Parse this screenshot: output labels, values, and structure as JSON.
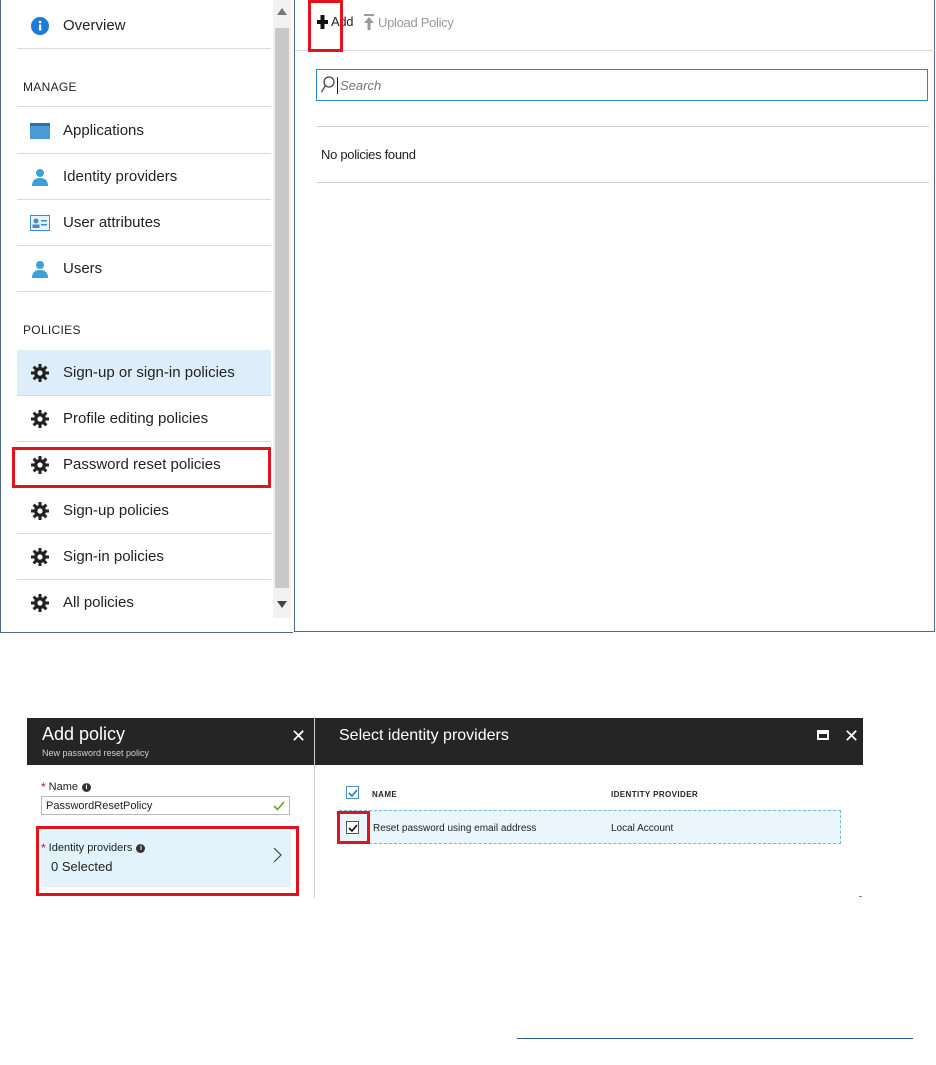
{
  "sidebar": {
    "overview": "Overview",
    "manage_header": "MANAGE",
    "manage_items": [
      "Applications",
      "Identity providers",
      "User attributes",
      "Users"
    ],
    "policies_header": "POLICIES",
    "policy_items": [
      "Sign-up or sign-in policies",
      "Profile editing policies",
      "Password reset policies",
      "Sign-up policies",
      "Sign-in policies",
      "All policies"
    ],
    "selected_item": "Sign-up or sign-in policies",
    "highlighted_item": "Password reset policies"
  },
  "toolbar": {
    "add_label": "Add",
    "upload_label": "Upload Policy"
  },
  "search": {
    "placeholder": "Search"
  },
  "content": {
    "empty_message": "No policies found"
  },
  "add_policy": {
    "title": "Add policy",
    "subtitle": "New password reset policy",
    "name_label": "Name",
    "name_value": "PasswordResetPolicy",
    "identity_label": "Identity providers",
    "identity_value": "0 Selected"
  },
  "select_idp": {
    "title": "Select identity providers",
    "columns": [
      "NAME",
      "IDENTITY PROVIDER"
    ],
    "rows": [
      {
        "name": "Reset password using email address",
        "provider": "Local Account",
        "checked": true
      }
    ]
  },
  "colors": {
    "highlight": "#e0141e",
    "selected_bg": "#ddeefa",
    "accent": "#2a88c8",
    "blade_header": "#252526",
    "overview_icon": "#1e7bd6"
  },
  "icons": [
    "info-icon",
    "application-icon",
    "user-icon",
    "contact-card-icon",
    "gear-icon",
    "plus-icon",
    "upload-icon",
    "search-icon",
    "close-icon",
    "maximize-icon",
    "chevron-right-icon",
    "checkmark-icon",
    "check-icon"
  ]
}
